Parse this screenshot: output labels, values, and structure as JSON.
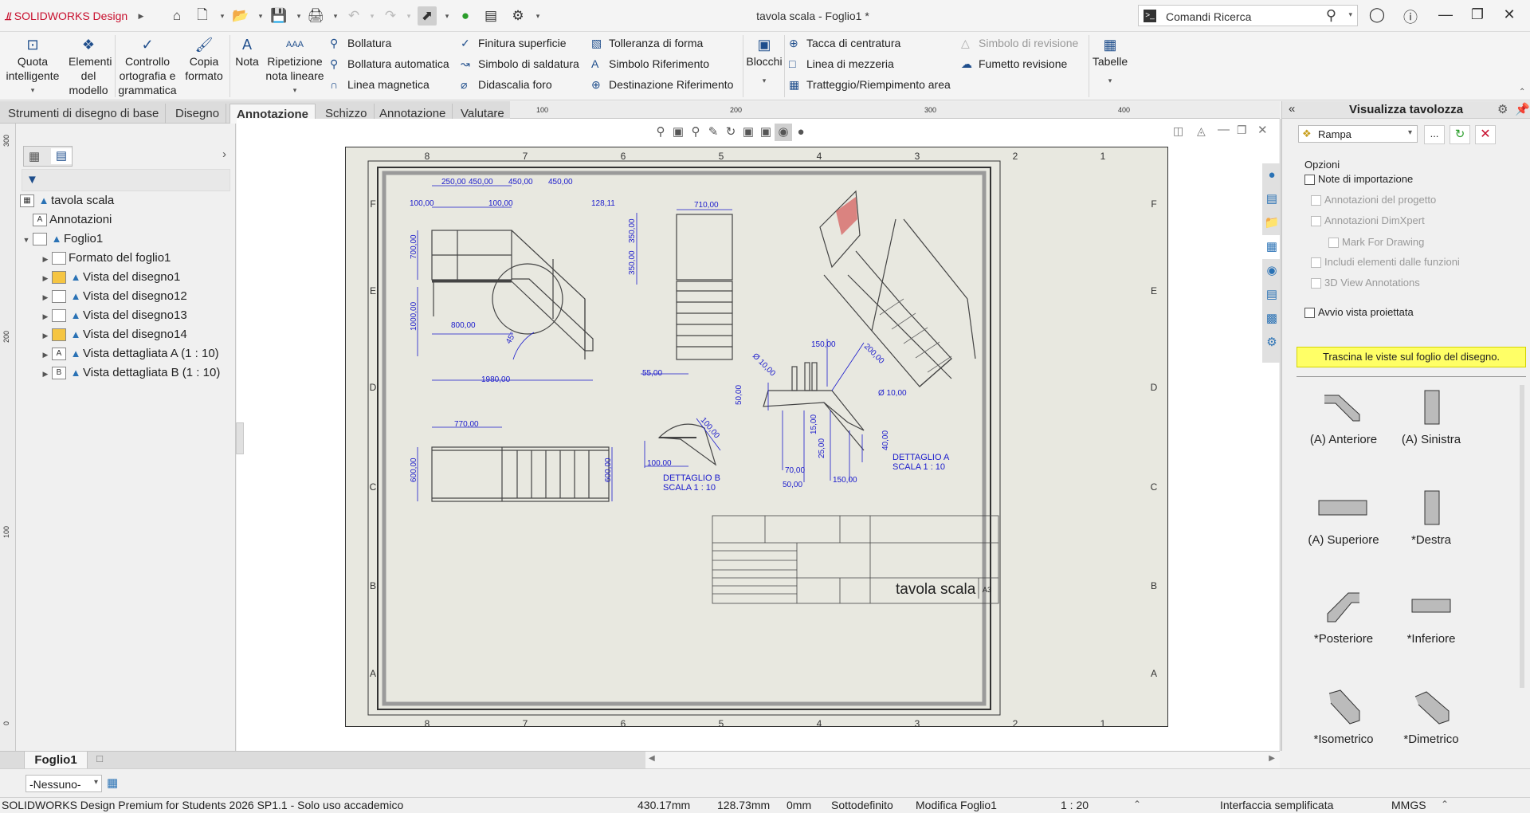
{
  "app": {
    "logo": "SOLIDWORKS Design",
    "brand": "SOLIDWORKS",
    "window_title": "tavola scala - Foglio1 *"
  },
  "search": {
    "placeholder": "Comandi Ricerca"
  },
  "ribbon": {
    "big": [
      {
        "label": "Quota intelligente",
        "icon": "smart-dimension-icon"
      },
      {
        "label": "Elementi del modello",
        "icon": "model-items-icon"
      },
      {
        "label": "Controllo ortografia e grammatica",
        "icon": "spell-check-icon"
      },
      {
        "label": "Copia formato",
        "icon": "format-painter-icon"
      },
      {
        "label": "Nota",
        "icon": "note-icon"
      },
      {
        "label": "Ripetizione nota lineare",
        "icon": "linear-note-pattern-icon"
      }
    ],
    "col1": [
      "Bollatura",
      "Bollatura automatica",
      "Linea magnetica"
    ],
    "col2": [
      "Finitura superficie",
      "Simbolo di saldatura",
      "Didascalia foro"
    ],
    "col3": [
      "Tolleranza di forma",
      "Simbolo Riferimento",
      "Destinazione Riferimento"
    ],
    "blocks": "Blocchi",
    "col4": [
      "Tacca di centratura",
      "Linea di mezzeria",
      "Tratteggio/Riempimento area"
    ],
    "col5": [
      "Simbolo di revisione",
      "Fumetto revisione"
    ],
    "tables": "Tabelle"
  },
  "tabs": [
    "Strumenti di disegno di base",
    "Disegno",
    "Annotazione",
    "Schizzo",
    "Annotazione",
    "Valutare"
  ],
  "active_tab": "Annotazione",
  "ruler": {
    "top": [
      "100",
      "200",
      "300",
      "400"
    ],
    "left": [
      "300",
      "200",
      "100",
      "0"
    ]
  },
  "tree": {
    "root": "tavola scala",
    "items": [
      {
        "label": "Annotazioni"
      },
      {
        "label": "Foglio1"
      },
      {
        "label": "Formato del foglio1"
      },
      {
        "label": "Vista del disegno1"
      },
      {
        "label": "Vista del disegno12"
      },
      {
        "label": "Vista del disegno13"
      },
      {
        "label": "Vista del disegno14"
      },
      {
        "label": "Vista dettagliata A (1 : 10)"
      },
      {
        "label": "Vista dettagliata B (1 : 10)"
      }
    ]
  },
  "drawing": {
    "zone_cols": [
      "8",
      "7",
      "6",
      "5",
      "4",
      "3",
      "2",
      "1"
    ],
    "zone_rows": [
      "F",
      "E",
      "D",
      "C",
      "B",
      "A"
    ],
    "dims": {
      "d250": "250,00",
      "d450a": "450,00",
      "d450b": "450,00",
      "d450c": "450,00",
      "d100a": "100,00",
      "d100b": "100,00",
      "d128": "128,11",
      "d700": "700,00",
      "d350a": "350,00",
      "d350b": "350,00",
      "d1000": "1000,00",
      "d800": "800,00",
      "d45": "45°",
      "d1980": "1980,00",
      "d710": "710,00",
      "d55": "55,00",
      "d770": "770,00",
      "d600a": "600,00",
      "d600b": "600,00",
      "d100c": "100,00",
      "d100d": "100,00",
      "d150a": "150,00",
      "d200": "200,00",
      "d10a": "Ø 10,00",
      "d10b": "Ø 10,00",
      "d50": "50,00",
      "d15": "15,00",
      "d25": "25,00",
      "d70": "70,00",
      "d50b": "50,00",
      "d150b": "150,00",
      "d40": "40,00"
    },
    "detail_a": [
      "DETTAGLIO A",
      "SCALA 1 : 10"
    ],
    "detail_b": [
      "DETTAGLIO B",
      "SCALA 1 : 10"
    ],
    "title": "tavola scala",
    "size": "A3"
  },
  "panel": {
    "title": "Visualizza tavolozza",
    "model": "Rampa",
    "options_label": "Opzioni",
    "options": [
      {
        "label": "Note di importazione",
        "enabled": true
      },
      {
        "label": "Annotazioni del progetto",
        "enabled": false
      },
      {
        "label": "Annotazioni DimXpert",
        "enabled": false
      },
      {
        "label": "Mark For Drawing",
        "enabled": false
      },
      {
        "label": "Includi elementi dalle funzioni",
        "enabled": false
      },
      {
        "label": "3D View Annotations",
        "enabled": false
      },
      {
        "label": "Avvio vista proiettata",
        "enabled": true
      }
    ],
    "hint": "Trascina le viste sul foglio del disegno.",
    "views": [
      "(A) Anteriore",
      "(A) Sinistra",
      "(A) Superiore",
      "*Destra",
      "*Posteriore",
      "*Inferiore",
      "*Isometrico",
      "*Dimetrico"
    ]
  },
  "sheet_tab": "Foglio1",
  "layer": "-Nessuno-",
  "status": {
    "product": "SOLIDWORKS Design Premium for Students 2026 SP1.1 - Solo uso accademico",
    "x": "430.17mm",
    "y": "128.73mm",
    "z": "0mm",
    "state": "Sottodefinito",
    "edit": "Modifica Foglio1",
    "scale": "1 : 20",
    "ui": "Interfaccia semplificata",
    "units": "MMGS"
  },
  "colors": {
    "dim": "#1a1acc",
    "accent": "#c8102e",
    "hint_bg": "#ffff66"
  }
}
